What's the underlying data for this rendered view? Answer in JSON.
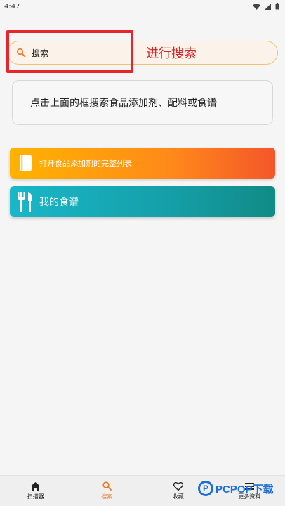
{
  "status_bar": {
    "time": "4:47"
  },
  "search": {
    "value": "搜索"
  },
  "annotation": {
    "text": "进行搜索"
  },
  "hint": {
    "text": "点击上面的框搜索食品添加剂、配料或食谱"
  },
  "cards": {
    "additives_label": "打开食品添加剂的完整列表",
    "recipes_label": "我的食谱"
  },
  "nav": {
    "scanner": "扫描器",
    "search": "搜索",
    "favorites": "收藏",
    "more": "更多资料"
  },
  "watermark": {
    "text": "PCPOP下载"
  },
  "colors": {
    "accent": "#e8782a",
    "highlight": "#e6262a",
    "orange_card": "#ff8a1a",
    "teal_card": "#159fa8"
  }
}
